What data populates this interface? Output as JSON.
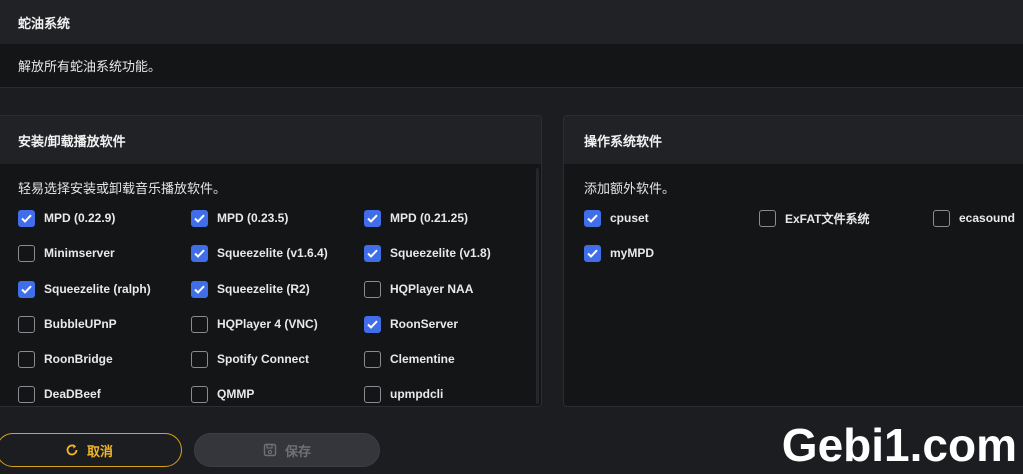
{
  "section": {
    "title": "蛇油系统",
    "description": "解放所有蛇油系统功能。"
  },
  "left_panel": {
    "title": "安装/卸载播放软件",
    "description": "轻易选择安装或卸载音乐播放软件。",
    "options": [
      {
        "label": "MPD (0.22.9)",
        "checked": true
      },
      {
        "label": "MPD (0.23.5)",
        "checked": true
      },
      {
        "label": "MPD (0.21.25)",
        "checked": true
      },
      {
        "label": "Minimserver",
        "checked": false
      },
      {
        "label": "Squeezelite (v1.6.4)",
        "checked": true
      },
      {
        "label": "Squeezelite (v1.8)",
        "checked": true
      },
      {
        "label": "Squeezelite (ralph)",
        "checked": true
      },
      {
        "label": "Squeezelite (R2)",
        "checked": true
      },
      {
        "label": "HQPlayer NAA",
        "checked": false
      },
      {
        "label": "BubbleUPnP",
        "checked": false
      },
      {
        "label": "HQPlayer 4 (VNC)",
        "checked": false
      },
      {
        "label": "RoonServer",
        "checked": true
      },
      {
        "label": "RoonBridge",
        "checked": false
      },
      {
        "label": "Spotify Connect",
        "checked": false
      },
      {
        "label": "Clementine",
        "checked": false
      },
      {
        "label": "DeaDBeef",
        "checked": false
      },
      {
        "label": "QMMP",
        "checked": false
      },
      {
        "label": "upmpdcli",
        "checked": false
      }
    ]
  },
  "right_panel": {
    "title": "操作系统软件",
    "description": "添加额外软件。",
    "options": [
      {
        "label": "cpuset",
        "checked": true
      },
      {
        "label": "ExFAT文件系统",
        "checked": false
      },
      {
        "label": "ecasound",
        "checked": false
      },
      {
        "label": "myMPD",
        "checked": true
      }
    ]
  },
  "actions": {
    "cancel_label": "取消",
    "save_label": "保存"
  },
  "watermark": "Gebi1.com",
  "colors": {
    "checkbox_checked": "#3f6ee8",
    "cancel_accent": "#f2b523"
  },
  "icons": {
    "cancel": "refresh-icon",
    "save": "save-icon",
    "check": "checkmark-icon"
  }
}
